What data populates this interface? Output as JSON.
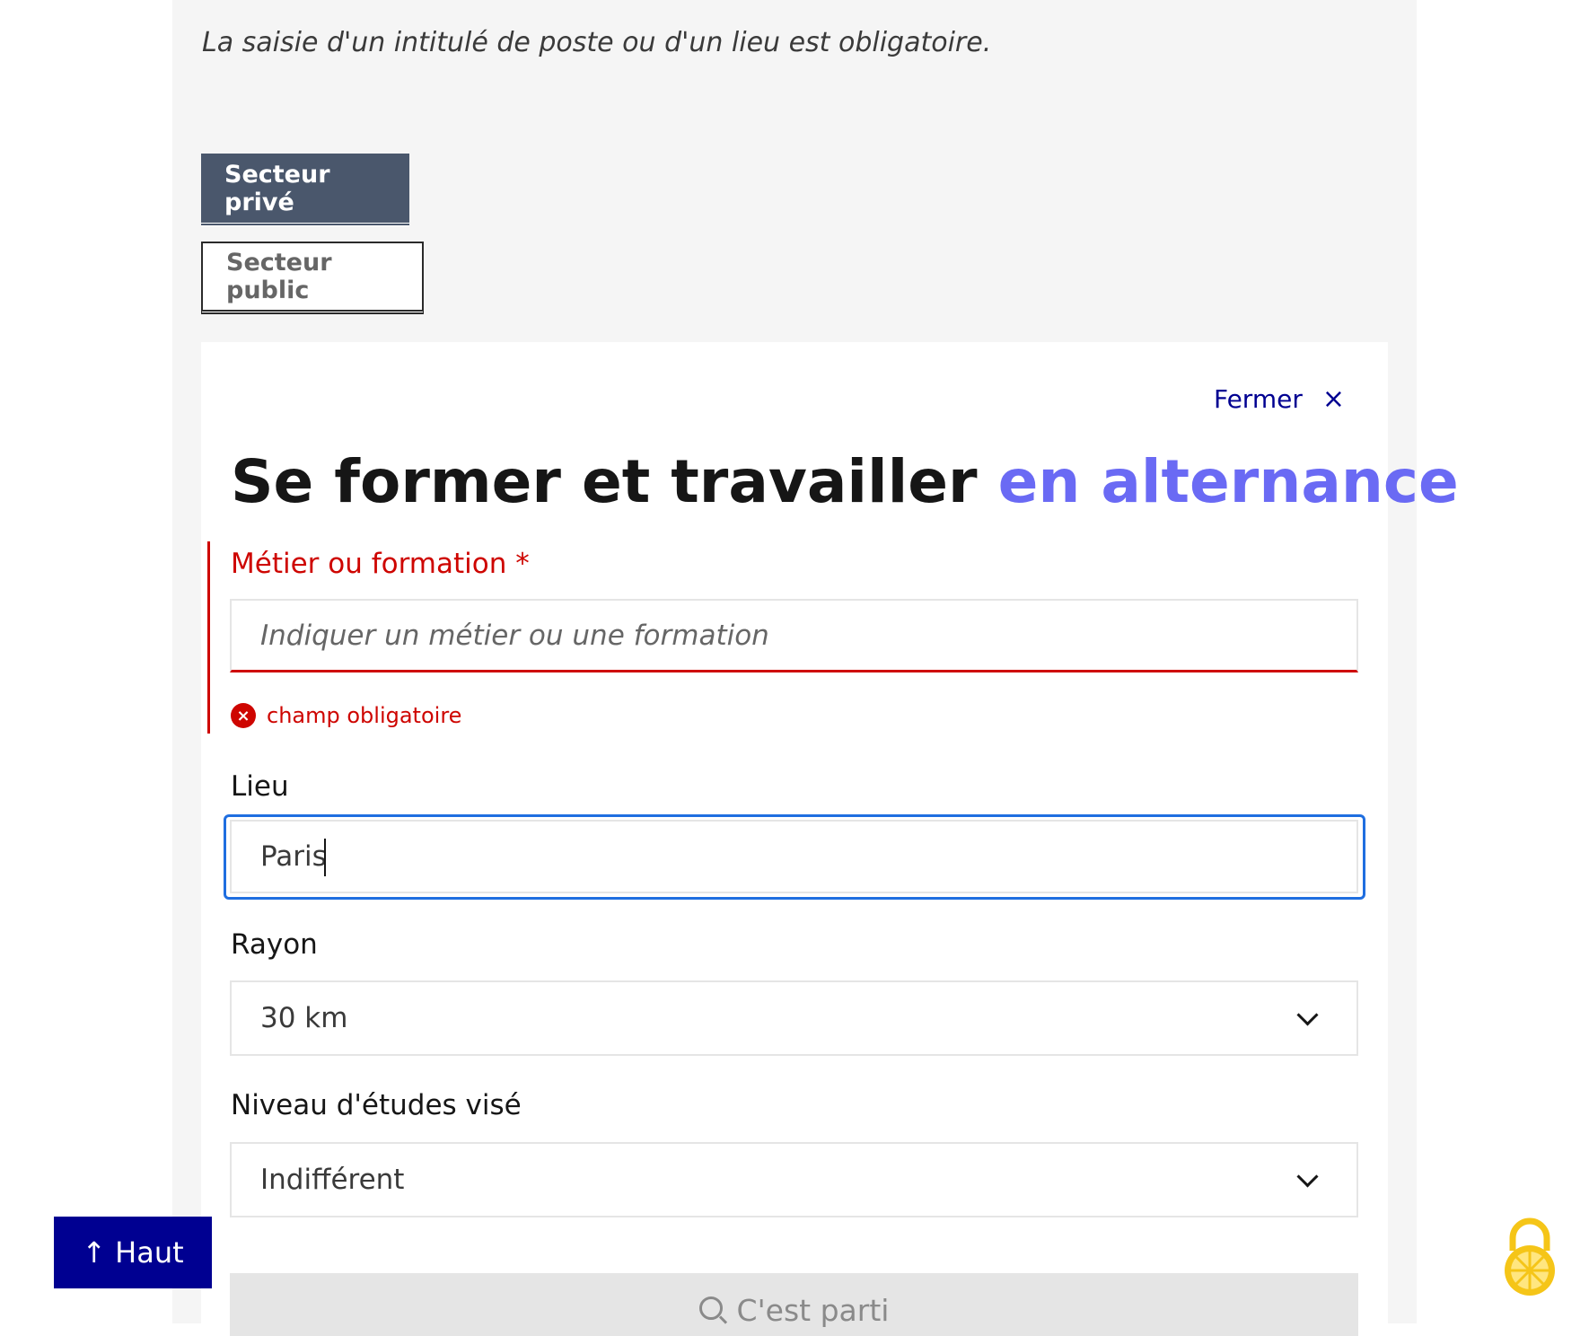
{
  "intro": {
    "text": "La saisie d'un intitulé de poste ou d'un lieu est obligatoire."
  },
  "sectors": {
    "private_label": "Secteur privé",
    "public_label": "Secteur public"
  },
  "card": {
    "close_label": "Fermer",
    "close_icon": "×",
    "title_main": "Se former et travailler ",
    "title_accent": "en alternance"
  },
  "form": {
    "metier": {
      "label": "Métier ou formation",
      "required_mark": " *",
      "placeholder": "Indiquer un métier ou une formation",
      "value": "",
      "error_text": "champ obligatoire",
      "error_icon": "×"
    },
    "lieu": {
      "label": "Lieu",
      "value": "Paris"
    },
    "rayon": {
      "label": "Rayon",
      "selected": "30 km"
    },
    "niveau": {
      "label": "Niveau d'études visé",
      "selected": "Indifférent"
    },
    "submit_label": "C'est parti"
  },
  "back_to_top": {
    "icon": "↑",
    "label": "Haut"
  },
  "colors": {
    "primary": "#000091",
    "accent": "#6a6af4",
    "error": "#ce0500",
    "focus": "#1f6ee0",
    "sector_active": "#4a576c",
    "lock_widget": "#f5c518"
  }
}
